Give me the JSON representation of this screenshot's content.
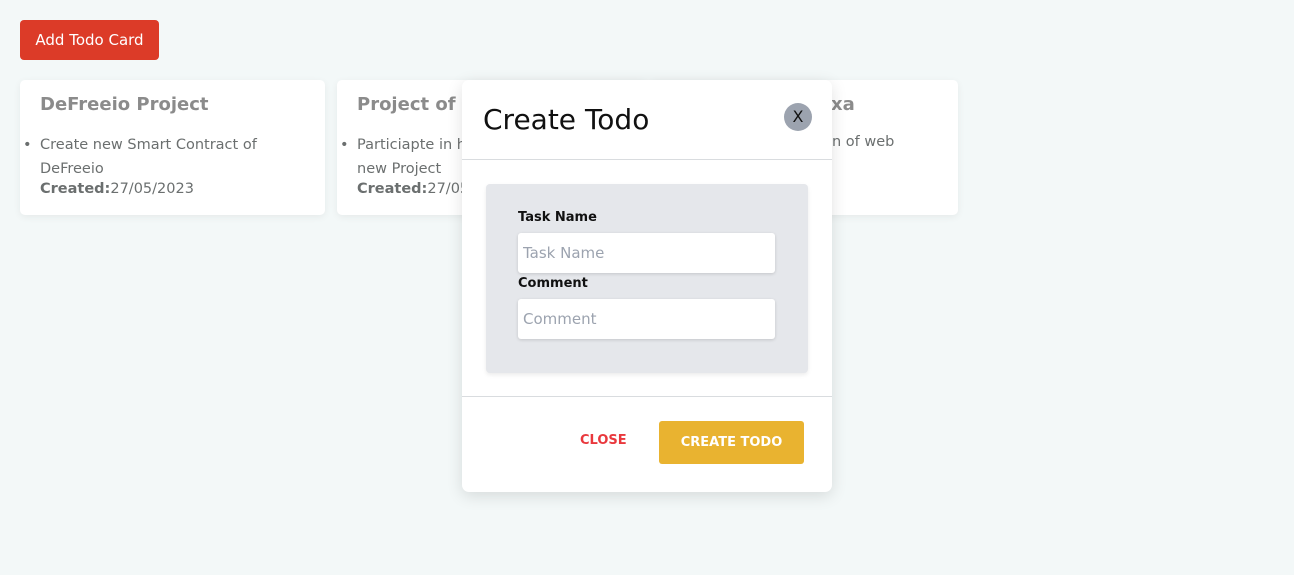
{
  "add_button_label": "Add Todo Card",
  "cards": [
    {
      "title": "DeFreeio Project",
      "item": "Create new Smart Contract of DeFreeio",
      "created_label": "Created:",
      "created_date": "27/05/2023"
    },
    {
      "title": "Project of C",
      "item_line1": "Particiapte in h",
      "item_line2": "new Project",
      "created_label": "Created:",
      "created_date": "27/05"
    },
    {
      "title": "xa",
      "item": "n of web"
    }
  ],
  "modal": {
    "title": "Create Todo",
    "close_x": "X",
    "task_label": "Task Name",
    "task_placeholder": "Task Name",
    "comment_label": "Comment",
    "comment_placeholder": "Comment",
    "close_label": "CLOSE",
    "create_label": "CREATE TODO"
  }
}
